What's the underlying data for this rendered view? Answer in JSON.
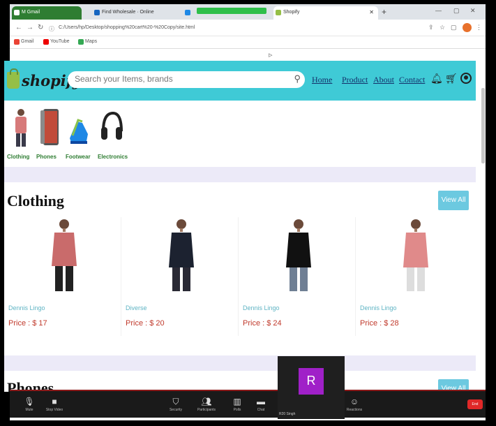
{
  "browser": {
    "tabs": [
      "M Gmail",
      "Find Wholesale · Online",
      "",
      "Shopify"
    ],
    "url": "C:/Users/hp/Desktop/shopping%20cart%20-%20Copy/site.html",
    "bookmarks": [
      "Gmail",
      "YouTube",
      "Maps"
    ]
  },
  "nav": {
    "logo": "shopify",
    "search_placeholder": "Search your Items, brands",
    "links": [
      "Home",
      "Product",
      "About",
      "Contact"
    ]
  },
  "categories": [
    "Clothing",
    "Phones",
    "Footwear",
    "Electronics"
  ],
  "clothing": {
    "title": "Clothing",
    "view_all": "View All",
    "products": [
      {
        "name": "Dennis Lingo",
        "price": "Price : $ 17",
        "color": "#c96b6b"
      },
      {
        "name": "Diverse",
        "price": "Price : $ 20",
        "color": "#1c2230"
      },
      {
        "name": "Dennis Lingo",
        "price": "Price : $ 24",
        "color": "#111111"
      },
      {
        "name": "Dennis Lingo",
        "price": "Price : $ 28",
        "color": "#e08a8a"
      }
    ]
  },
  "phones": {
    "title": "Phones",
    "view_all": "View All"
  },
  "meeting": {
    "participant_initial": "R",
    "participant_name": "R20 Singh",
    "controls": [
      "Mute",
      "Stop Video",
      "Security",
      "Participants",
      "Polls",
      "Chat",
      "Share Screen",
      "Record",
      "Reactions"
    ],
    "end": "End"
  },
  "colors": {
    "nav": "#3fcad6",
    "accent": "#2e7d32",
    "price": "#c0392b"
  }
}
